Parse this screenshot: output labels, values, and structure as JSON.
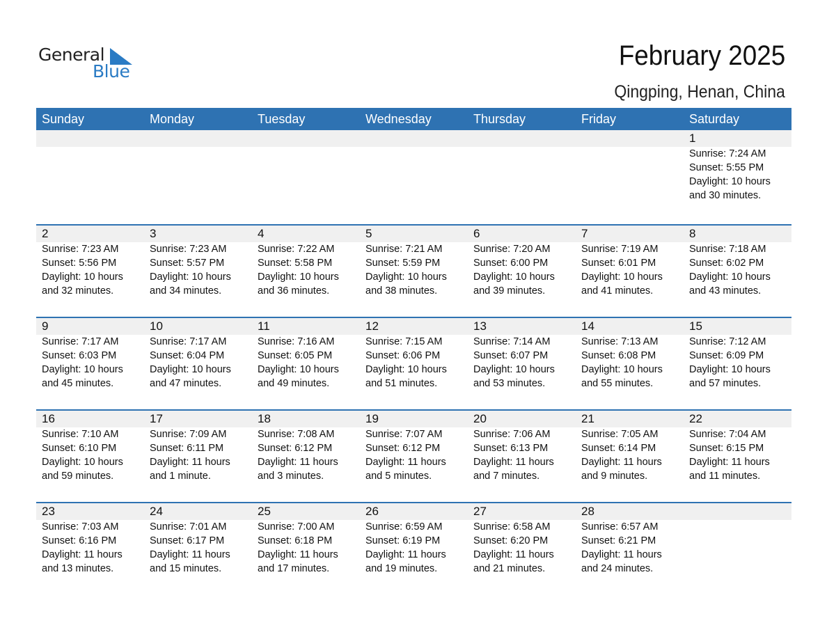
{
  "logo": {
    "word1": "General",
    "word2": "Blue",
    "brand_color": "#2a7bc4"
  },
  "title": "February 2025",
  "location": "Qingping, Henan, China",
  "colors": {
    "header_bg": "#2e72b2",
    "day_band": "#f0f0f0"
  },
  "weekdays": [
    "Sunday",
    "Monday",
    "Tuesday",
    "Wednesday",
    "Thursday",
    "Friday",
    "Saturday"
  ],
  "weeks": [
    [
      {
        "day": "",
        "sunrise": "",
        "sunset": "",
        "daylight": "",
        "daylight2": ""
      },
      {
        "day": "",
        "sunrise": "",
        "sunset": "",
        "daylight": "",
        "daylight2": ""
      },
      {
        "day": "",
        "sunrise": "",
        "sunset": "",
        "daylight": "",
        "daylight2": ""
      },
      {
        "day": "",
        "sunrise": "",
        "sunset": "",
        "daylight": "",
        "daylight2": ""
      },
      {
        "day": "",
        "sunrise": "",
        "sunset": "",
        "daylight": "",
        "daylight2": ""
      },
      {
        "day": "",
        "sunrise": "",
        "sunset": "",
        "daylight": "",
        "daylight2": ""
      },
      {
        "day": "1",
        "sunrise": "Sunrise: 7:24 AM",
        "sunset": "Sunset: 5:55 PM",
        "daylight": "Daylight: 10 hours",
        "daylight2": "and 30 minutes."
      }
    ],
    [
      {
        "day": "2",
        "sunrise": "Sunrise: 7:23 AM",
        "sunset": "Sunset: 5:56 PM",
        "daylight": "Daylight: 10 hours",
        "daylight2": "and 32 minutes."
      },
      {
        "day": "3",
        "sunrise": "Sunrise: 7:23 AM",
        "sunset": "Sunset: 5:57 PM",
        "daylight": "Daylight: 10 hours",
        "daylight2": "and 34 minutes."
      },
      {
        "day": "4",
        "sunrise": "Sunrise: 7:22 AM",
        "sunset": "Sunset: 5:58 PM",
        "daylight": "Daylight: 10 hours",
        "daylight2": "and 36 minutes."
      },
      {
        "day": "5",
        "sunrise": "Sunrise: 7:21 AM",
        "sunset": "Sunset: 5:59 PM",
        "daylight": "Daylight: 10 hours",
        "daylight2": "and 38 minutes."
      },
      {
        "day": "6",
        "sunrise": "Sunrise: 7:20 AM",
        "sunset": "Sunset: 6:00 PM",
        "daylight": "Daylight: 10 hours",
        "daylight2": "and 39 minutes."
      },
      {
        "day": "7",
        "sunrise": "Sunrise: 7:19 AM",
        "sunset": "Sunset: 6:01 PM",
        "daylight": "Daylight: 10 hours",
        "daylight2": "and 41 minutes."
      },
      {
        "day": "8",
        "sunrise": "Sunrise: 7:18 AM",
        "sunset": "Sunset: 6:02 PM",
        "daylight": "Daylight: 10 hours",
        "daylight2": "and 43 minutes."
      }
    ],
    [
      {
        "day": "9",
        "sunrise": "Sunrise: 7:17 AM",
        "sunset": "Sunset: 6:03 PM",
        "daylight": "Daylight: 10 hours",
        "daylight2": "and 45 minutes."
      },
      {
        "day": "10",
        "sunrise": "Sunrise: 7:17 AM",
        "sunset": "Sunset: 6:04 PM",
        "daylight": "Daylight: 10 hours",
        "daylight2": "and 47 minutes."
      },
      {
        "day": "11",
        "sunrise": "Sunrise: 7:16 AM",
        "sunset": "Sunset: 6:05 PM",
        "daylight": "Daylight: 10 hours",
        "daylight2": "and 49 minutes."
      },
      {
        "day": "12",
        "sunrise": "Sunrise: 7:15 AM",
        "sunset": "Sunset: 6:06 PM",
        "daylight": "Daylight: 10 hours",
        "daylight2": "and 51 minutes."
      },
      {
        "day": "13",
        "sunrise": "Sunrise: 7:14 AM",
        "sunset": "Sunset: 6:07 PM",
        "daylight": "Daylight: 10 hours",
        "daylight2": "and 53 minutes."
      },
      {
        "day": "14",
        "sunrise": "Sunrise: 7:13 AM",
        "sunset": "Sunset: 6:08 PM",
        "daylight": "Daylight: 10 hours",
        "daylight2": "and 55 minutes."
      },
      {
        "day": "15",
        "sunrise": "Sunrise: 7:12 AM",
        "sunset": "Sunset: 6:09 PM",
        "daylight": "Daylight: 10 hours",
        "daylight2": "and 57 minutes."
      }
    ],
    [
      {
        "day": "16",
        "sunrise": "Sunrise: 7:10 AM",
        "sunset": "Sunset: 6:10 PM",
        "daylight": "Daylight: 10 hours",
        "daylight2": "and 59 minutes."
      },
      {
        "day": "17",
        "sunrise": "Sunrise: 7:09 AM",
        "sunset": "Sunset: 6:11 PM",
        "daylight": "Daylight: 11 hours",
        "daylight2": "and 1 minute."
      },
      {
        "day": "18",
        "sunrise": "Sunrise: 7:08 AM",
        "sunset": "Sunset: 6:12 PM",
        "daylight": "Daylight: 11 hours",
        "daylight2": "and 3 minutes."
      },
      {
        "day": "19",
        "sunrise": "Sunrise: 7:07 AM",
        "sunset": "Sunset: 6:12 PM",
        "daylight": "Daylight: 11 hours",
        "daylight2": "and 5 minutes."
      },
      {
        "day": "20",
        "sunrise": "Sunrise: 7:06 AM",
        "sunset": "Sunset: 6:13 PM",
        "daylight": "Daylight: 11 hours",
        "daylight2": "and 7 minutes."
      },
      {
        "day": "21",
        "sunrise": "Sunrise: 7:05 AM",
        "sunset": "Sunset: 6:14 PM",
        "daylight": "Daylight: 11 hours",
        "daylight2": "and 9 minutes."
      },
      {
        "day": "22",
        "sunrise": "Sunrise: 7:04 AM",
        "sunset": "Sunset: 6:15 PM",
        "daylight": "Daylight: 11 hours",
        "daylight2": "and 11 minutes."
      }
    ],
    [
      {
        "day": "23",
        "sunrise": "Sunrise: 7:03 AM",
        "sunset": "Sunset: 6:16 PM",
        "daylight": "Daylight: 11 hours",
        "daylight2": "and 13 minutes."
      },
      {
        "day": "24",
        "sunrise": "Sunrise: 7:01 AM",
        "sunset": "Sunset: 6:17 PM",
        "daylight": "Daylight: 11 hours",
        "daylight2": "and 15 minutes."
      },
      {
        "day": "25",
        "sunrise": "Sunrise: 7:00 AM",
        "sunset": "Sunset: 6:18 PM",
        "daylight": "Daylight: 11 hours",
        "daylight2": "and 17 minutes."
      },
      {
        "day": "26",
        "sunrise": "Sunrise: 6:59 AM",
        "sunset": "Sunset: 6:19 PM",
        "daylight": "Daylight: 11 hours",
        "daylight2": "and 19 minutes."
      },
      {
        "day": "27",
        "sunrise": "Sunrise: 6:58 AM",
        "sunset": "Sunset: 6:20 PM",
        "daylight": "Daylight: 11 hours",
        "daylight2": "and 21 minutes."
      },
      {
        "day": "28",
        "sunrise": "Sunrise: 6:57 AM",
        "sunset": "Sunset: 6:21 PM",
        "daylight": "Daylight: 11 hours",
        "daylight2": "and 24 minutes."
      },
      {
        "day": "",
        "sunrise": "",
        "sunset": "",
        "daylight": "",
        "daylight2": ""
      }
    ]
  ]
}
